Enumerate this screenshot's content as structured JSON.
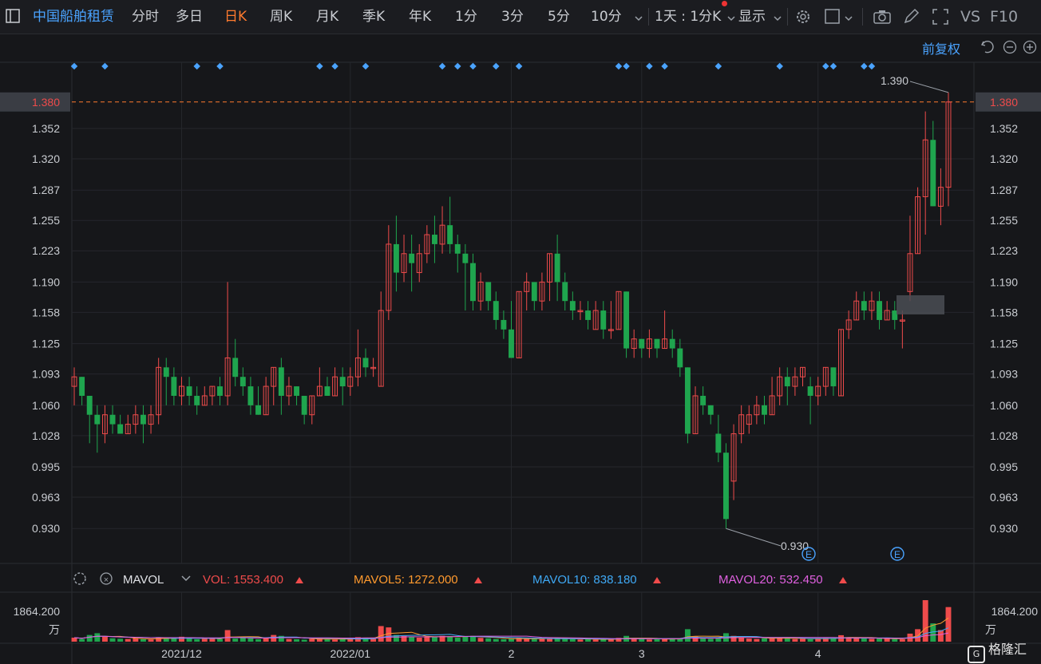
{
  "toolbar": {
    "stock_name": "中国船舶租赁",
    "tabs": [
      {
        "label": "分时"
      },
      {
        "label": "多日"
      },
      {
        "label": "日K",
        "active": true
      },
      {
        "label": "周K"
      },
      {
        "label": "月K"
      },
      {
        "label": "季K"
      },
      {
        "label": "年K"
      },
      {
        "label": "1分"
      },
      {
        "label": "3分"
      },
      {
        "label": "5分"
      },
      {
        "label": "10分"
      }
    ],
    "interval_label": "1天 : 1分K",
    "display_label": "显示",
    "vs_label": "VS",
    "f10_label": "F10",
    "icons": [
      "settings-icon",
      "square-icon",
      "camera-icon",
      "pen-icon",
      "fullscreen-icon"
    ]
  },
  "sub_toolbar": {
    "adjust_label": "前复权",
    "icons": [
      "undo-icon",
      "zoom-out-icon",
      "zoom-in-icon"
    ]
  },
  "colors": {
    "up": "#ef4b4b",
    "down": "#1fa54e",
    "accent": "#ff7a2e",
    "blue": "#4aa3ff"
  },
  "chart_data": {
    "type": "candlestick",
    "current_price_label": "1.380",
    "price_ticks": [
      "1.352",
      "1.320",
      "1.287",
      "1.255",
      "1.223",
      "1.190",
      "1.158",
      "1.125",
      "1.093",
      "1.060",
      "1.028",
      "0.995",
      "0.963",
      "0.930"
    ],
    "ylim": [
      0.91,
      1.4
    ],
    "max_label": "1.390",
    "min_label": "0.930",
    "x_tick_labels": [
      {
        "label": "2021/12",
        "index": 14
      },
      {
        "label": "2022/01",
        "index": 36
      },
      {
        "label": "2",
        "index": 57
      },
      {
        "label": "3",
        "index": 74
      },
      {
        "label": "4",
        "index": 97
      }
    ],
    "event_markers": [
      "E",
      "E"
    ],
    "candles": [
      [
        1.08,
        1.09,
        1.06,
        1.1
      ],
      [
        1.09,
        1.07,
        1.06,
        1.09
      ],
      [
        1.07,
        1.05,
        1.02,
        1.07
      ],
      [
        1.05,
        1.04,
        1.01,
        1.06
      ],
      [
        1.03,
        1.05,
        1.02,
        1.06
      ],
      [
        1.05,
        1.04,
        1.03,
        1.06
      ],
      [
        1.04,
        1.03,
        1.03,
        1.05
      ],
      [
        1.03,
        1.04,
        1.03,
        1.05
      ],
      [
        1.04,
        1.05,
        1.03,
        1.06
      ],
      [
        1.05,
        1.04,
        1.02,
        1.06
      ],
      [
        1.04,
        1.05,
        1.03,
        1.06
      ],
      [
        1.05,
        1.1,
        1.04,
        1.11
      ],
      [
        1.1,
        1.09,
        1.06,
        1.11
      ],
      [
        1.09,
        1.07,
        1.06,
        1.1
      ],
      [
        1.07,
        1.08,
        1.06,
        1.09
      ],
      [
        1.08,
        1.07,
        1.06,
        1.09
      ],
      [
        1.07,
        1.06,
        1.05,
        1.08
      ],
      [
        1.06,
        1.07,
        1.06,
        1.08
      ],
      [
        1.07,
        1.08,
        1.06,
        1.08
      ],
      [
        1.08,
        1.07,
        1.06,
        1.09
      ],
      [
        1.07,
        1.11,
        1.06,
        1.19
      ],
      [
        1.11,
        1.09,
        1.08,
        1.13
      ],
      [
        1.09,
        1.08,
        1.07,
        1.1
      ],
      [
        1.08,
        1.06,
        1.05,
        1.09
      ],
      [
        1.06,
        1.05,
        1.05,
        1.08
      ],
      [
        1.05,
        1.08,
        1.05,
        1.09
      ],
      [
        1.08,
        1.1,
        1.06,
        1.1
      ],
      [
        1.1,
        1.07,
        1.05,
        1.11
      ],
      [
        1.07,
        1.08,
        1.06,
        1.09
      ],
      [
        1.08,
        1.07,
        1.06,
        1.08
      ],
      [
        1.07,
        1.05,
        1.04,
        1.07
      ],
      [
        1.05,
        1.07,
        1.04,
        1.07
      ],
      [
        1.07,
        1.08,
        1.07,
        1.1
      ],
      [
        1.08,
        1.07,
        1.07,
        1.09
      ],
      [
        1.07,
        1.09,
        1.07,
        1.1
      ],
      [
        1.09,
        1.08,
        1.06,
        1.1
      ],
      [
        1.08,
        1.09,
        1.07,
        1.1
      ],
      [
        1.09,
        1.11,
        1.08,
        1.14
      ],
      [
        1.11,
        1.1,
        1.09,
        1.12
      ],
      [
        1.1,
        1.1,
        1.09,
        1.11
      ],
      [
        1.08,
        1.16,
        1.08,
        1.18
      ],
      [
        1.16,
        1.23,
        1.15,
        1.25
      ],
      [
        1.23,
        1.2,
        1.18,
        1.26
      ],
      [
        1.2,
        1.22,
        1.19,
        1.24
      ],
      [
        1.22,
        1.21,
        1.18,
        1.24
      ],
      [
        1.2,
        1.22,
        1.19,
        1.23
      ],
      [
        1.22,
        1.24,
        1.21,
        1.25
      ],
      [
        1.24,
        1.23,
        1.21,
        1.26
      ],
      [
        1.23,
        1.25,
        1.22,
        1.27
      ],
      [
        1.25,
        1.23,
        1.22,
        1.28
      ],
      [
        1.23,
        1.22,
        1.2,
        1.24
      ],
      [
        1.22,
        1.21,
        1.16,
        1.23
      ],
      [
        1.21,
        1.17,
        1.16,
        1.22
      ],
      [
        1.17,
        1.19,
        1.16,
        1.2
      ],
      [
        1.19,
        1.17,
        1.16,
        1.19
      ],
      [
        1.17,
        1.15,
        1.14,
        1.18
      ],
      [
        1.15,
        1.14,
        1.13,
        1.16
      ],
      [
        1.14,
        1.11,
        1.11,
        1.17
      ],
      [
        1.11,
        1.18,
        1.11,
        1.18
      ],
      [
        1.18,
        1.19,
        1.16,
        1.2
      ],
      [
        1.19,
        1.17,
        1.16,
        1.19
      ],
      [
        1.17,
        1.19,
        1.16,
        1.2
      ],
      [
        1.19,
        1.22,
        1.17,
        1.22
      ],
      [
        1.22,
        1.19,
        1.17,
        1.24
      ],
      [
        1.19,
        1.17,
        1.16,
        1.2
      ],
      [
        1.17,
        1.16,
        1.15,
        1.18
      ],
      [
        1.16,
        1.16,
        1.15,
        1.17
      ],
      [
        1.16,
        1.15,
        1.14,
        1.17
      ],
      [
        1.14,
        1.16,
        1.14,
        1.17
      ],
      [
        1.16,
        1.14,
        1.13,
        1.17
      ],
      [
        1.14,
        1.14,
        1.13,
        1.17
      ],
      [
        1.14,
        1.18,
        1.14,
        1.18
      ],
      [
        1.18,
        1.12,
        1.11,
        1.18
      ],
      [
        1.12,
        1.13,
        1.11,
        1.14
      ],
      [
        1.13,
        1.12,
        1.11,
        1.13
      ],
      [
        1.12,
        1.13,
        1.11,
        1.14
      ],
      [
        1.13,
        1.12,
        1.11,
        1.13
      ],
      [
        1.12,
        1.13,
        1.12,
        1.16
      ],
      [
        1.13,
        1.12,
        1.11,
        1.14
      ],
      [
        1.12,
        1.1,
        1.09,
        1.13
      ],
      [
        1.1,
        1.03,
        1.02,
        1.1
      ],
      [
        1.03,
        1.07,
        1.03,
        1.08
      ],
      [
        1.07,
        1.06,
        1.05,
        1.08
      ],
      [
        1.06,
        1.05,
        1.04,
        1.06
      ],
      [
        1.03,
        1.01,
        1.0,
        1.05
      ],
      [
        1.01,
        0.94,
        0.93,
        1.02
      ],
      [
        0.98,
        1.03,
        0.96,
        1.04
      ],
      [
        1.03,
        1.05,
        1.02,
        1.06
      ],
      [
        1.04,
        1.05,
        1.03,
        1.06
      ],
      [
        1.05,
        1.06,
        1.04,
        1.07
      ],
      [
        1.06,
        1.05,
        1.04,
        1.07
      ],
      [
        1.05,
        1.07,
        1.05,
        1.09
      ],
      [
        1.07,
        1.09,
        1.06,
        1.1
      ],
      [
        1.09,
        1.08,
        1.06,
        1.1
      ],
      [
        1.08,
        1.09,
        1.07,
        1.1
      ],
      [
        1.09,
        1.1,
        1.08,
        1.1
      ],
      [
        1.08,
        1.07,
        1.04,
        1.09
      ],
      [
        1.07,
        1.08,
        1.06,
        1.09
      ],
      [
        1.08,
        1.1,
        1.07,
        1.1
      ],
      [
        1.1,
        1.08,
        1.07,
        1.1
      ],
      [
        1.07,
        1.14,
        1.07,
        1.14
      ],
      [
        1.14,
        1.15,
        1.13,
        1.16
      ],
      [
        1.15,
        1.17,
        1.15,
        1.18
      ],
      [
        1.17,
        1.16,
        1.15,
        1.18
      ],
      [
        1.16,
        1.17,
        1.15,
        1.18
      ],
      [
        1.17,
        1.15,
        1.14,
        1.18
      ],
      [
        1.15,
        1.16,
        1.15,
        1.17
      ],
      [
        1.16,
        1.15,
        1.14,
        1.17
      ],
      [
        1.15,
        1.15,
        1.12,
        1.16
      ],
      [
        1.18,
        1.22,
        1.17,
        1.26
      ],
      [
        1.22,
        1.28,
        1.22,
        1.29
      ],
      [
        1.28,
        1.34,
        1.24,
        1.37
      ],
      [
        1.34,
        1.27,
        1.27,
        1.36
      ],
      [
        1.27,
        1.29,
        1.25,
        1.31
      ],
      [
        1.29,
        1.38,
        1.27,
        1.39
      ]
    ],
    "event_dots": [
      0,
      4,
      16,
      19,
      32,
      34,
      38,
      48,
      50,
      52,
      55,
      58,
      71,
      72,
      75,
      77,
      84,
      92,
      98,
      99,
      103,
      104
    ],
    "volume_indicator": {
      "name": "MAVOL",
      "vol_label": "VOL:",
      "vol": "1553.400",
      "mavol5_label": "MAVOL5:",
      "mavol5": "1272.000",
      "mavol10_label": "MAVOL10:",
      "mavol10": "838.180",
      "mavol20_label": "MAVOL20:",
      "mavol20": "532.450",
      "axis_top": "1864.200",
      "axis_unit": "万",
      "max": 1864.2,
      "volumes": [
        180,
        120,
        300,
        380,
        220,
        150,
        130,
        120,
        160,
        110,
        100,
        200,
        180,
        140,
        220,
        150,
        110,
        130,
        140,
        120,
        520,
        140,
        180,
        150,
        110,
        170,
        300,
        260,
        120,
        110,
        90,
        130,
        140,
        110,
        100,
        120,
        110,
        200,
        160,
        130,
        700,
        640,
        300,
        260,
        220,
        180,
        240,
        210,
        260,
        240,
        180,
        250,
        260,
        170,
        150,
        120,
        110,
        140,
        160,
        130,
        120,
        140,
        150,
        160,
        130,
        110,
        100,
        110,
        100,
        120,
        100,
        170,
        260,
        140,
        120,
        100,
        110,
        130,
        150,
        140,
        560,
        240,
        140,
        130,
        160,
        380,
        260,
        180,
        140,
        120,
        150,
        160,
        180,
        150,
        120,
        130,
        110,
        160,
        170,
        130,
        290,
        200,
        150,
        140,
        130,
        160,
        140,
        120,
        110,
        360,
        560,
        1864,
        820,
        520,
        1553
      ]
    }
  },
  "footer": {
    "logo_text": "格隆汇"
  }
}
